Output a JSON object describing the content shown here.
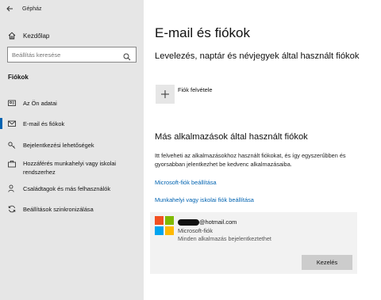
{
  "window": {
    "title": "Gépház"
  },
  "sidebar": {
    "home_label": "Kezdőlap",
    "search_placeholder": "Beállítás keresése",
    "section_title": "Fiókok",
    "items": [
      {
        "label": "Az Ön adatai",
        "icon": "person-card-icon",
        "selected": false
      },
      {
        "label": "E-mail és fiókok",
        "icon": "mail-icon",
        "selected": true
      },
      {
        "label": "Bejelentkezési lehetőségek",
        "icon": "key-icon",
        "selected": false
      },
      {
        "label": "Hozzáférés munkahelyi vagy iskolai rendszerhez",
        "icon": "briefcase-icon",
        "selected": false
      },
      {
        "label": "Családtagok és más felhasználók",
        "icon": "people-icon",
        "selected": false
      },
      {
        "label": "Beállítások szinkronizálása",
        "icon": "sync-icon",
        "selected": false
      }
    ]
  },
  "main": {
    "title": "E-mail és fiókok",
    "section1_heading": "Levelezés, naptár és névjegyek által használt fiókok",
    "add_account_label": "Fiók felvétele",
    "section2_heading": "Más alkalmazások által használt fiókok",
    "section2_text": "Itt felveheti az alkalmazásokhoz használt fiókokat, és így egyszerűbben és gyorsabban jelentkezhet be kedvenc alkalmazásaiba.",
    "link_microsoft": "Microsoft-fiók beállítása",
    "link_work": "Munkahelyi vagy iskolai fiók beállítása",
    "account": {
      "email_suffix": "@hotmail.com",
      "type": "Microsoft-fiók",
      "description": "Minden alkalmazás bejelentkeztethet",
      "manage_label": "Kezelés"
    }
  },
  "colors": {
    "accent": "#0063b1",
    "sidebar_bg": "#e6e6e6"
  }
}
